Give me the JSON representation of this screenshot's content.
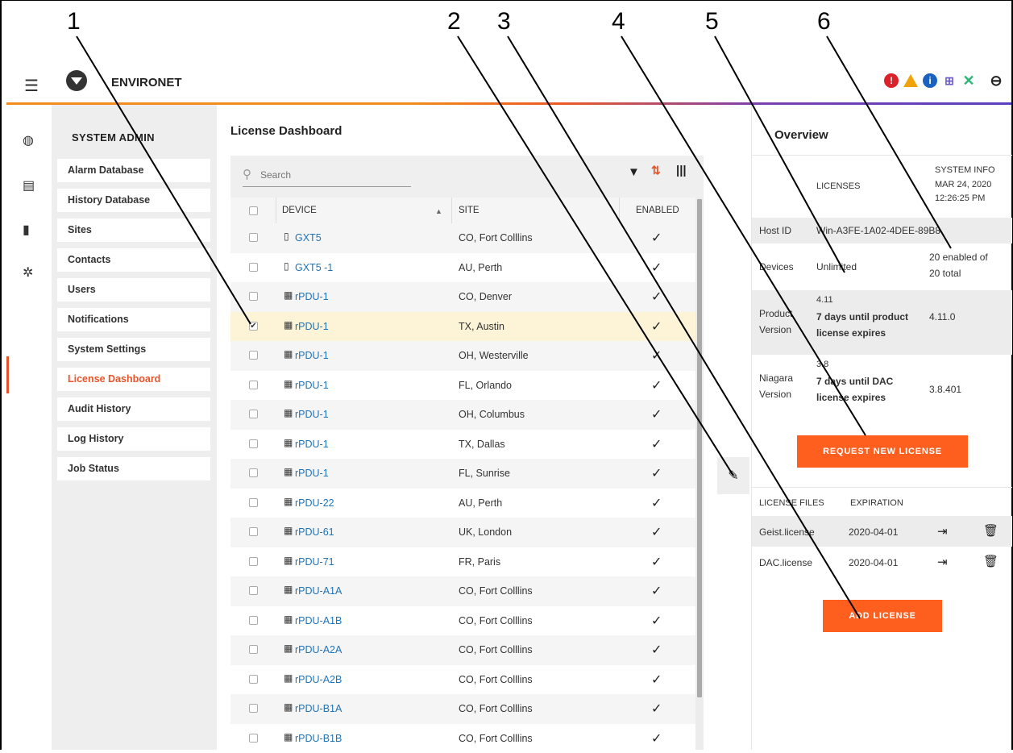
{
  "callouts": [
    "1",
    "2",
    "3",
    "4",
    "5",
    "6"
  ],
  "header": {
    "brand": "ENVIRONET",
    "icons": [
      "menu-icon",
      "vertiv-logo-icon",
      "alarm-icon",
      "warning-icon",
      "info-icon",
      "network-icon",
      "tools-icon",
      "user-icon"
    ],
    "colors": {
      "alarm": "#d9222a",
      "warning": "#f0a30a",
      "info": "#1a62c0",
      "network": "#6a5acd",
      "tools": "#2bb673",
      "accent": "#e8542a"
    }
  },
  "rail": [
    "globe-icon",
    "reports-icon",
    "devices-icon",
    "settings-icon"
  ],
  "sidebar": {
    "title": "SYSTEM ADMIN",
    "items": [
      {
        "label": "Alarm Database"
      },
      {
        "label": "History Database"
      },
      {
        "label": "Sites"
      },
      {
        "label": "Contacts"
      },
      {
        "label": "Users"
      },
      {
        "label": "Notifications"
      },
      {
        "label": "System Settings"
      },
      {
        "label": "License Dashboard",
        "active": true
      },
      {
        "label": "Audit History"
      },
      {
        "label": "Log History"
      },
      {
        "label": "Job Status"
      }
    ]
  },
  "main": {
    "title": "License Dashboard",
    "search_placeholder": "Search",
    "columns": [
      "DEVICE",
      "SITE",
      "ENABLED"
    ],
    "rows": [
      {
        "device": "GXT5",
        "icon": "ups",
        "site": "CO, Fort Colllins",
        "enabled": true,
        "checked": false
      },
      {
        "device": "GXT5 -1",
        "icon": "ups",
        "site": "AU, Perth",
        "enabled": true,
        "checked": false
      },
      {
        "device": "rPDU-1",
        "icon": "pdu",
        "site": "CO, Denver",
        "enabled": true,
        "checked": false
      },
      {
        "device": "rPDU-1",
        "icon": "pdu",
        "site": "TX, Austin",
        "enabled": true,
        "checked": true
      },
      {
        "device": "rPDU-1",
        "icon": "pdu",
        "site": "OH, Westerville",
        "enabled": true,
        "checked": false
      },
      {
        "device": "rPDU-1",
        "icon": "pdu",
        "site": "FL, Orlando",
        "enabled": true,
        "checked": false
      },
      {
        "device": "rPDU-1",
        "icon": "pdu",
        "site": "OH, Columbus",
        "enabled": true,
        "checked": false
      },
      {
        "device": "rPDU-1",
        "icon": "pdu",
        "site": "TX, Dallas",
        "enabled": true,
        "checked": false
      },
      {
        "device": "rPDU-1",
        "icon": "pdu",
        "site": "FL, Sunrise",
        "enabled": true,
        "checked": false
      },
      {
        "device": "rPDU-22",
        "icon": "pdu",
        "site": "AU, Perth",
        "enabled": true,
        "checked": false
      },
      {
        "device": "rPDU-61",
        "icon": "pdu",
        "site": "UK, London",
        "enabled": true,
        "checked": false
      },
      {
        "device": "rPDU-71",
        "icon": "pdu",
        "site": "FR, Paris",
        "enabled": true,
        "checked": false
      },
      {
        "device": "rPDU-A1A",
        "icon": "pdu",
        "site": "CO, Fort Colllins",
        "enabled": true,
        "checked": false
      },
      {
        "device": "rPDU-A1B",
        "icon": "pdu",
        "site": "CO, Fort Colllins",
        "enabled": true,
        "checked": false
      },
      {
        "device": "rPDU-A2A",
        "icon": "pdu",
        "site": "CO, Fort Colllins",
        "enabled": true,
        "checked": false
      },
      {
        "device": "rPDU-A2B",
        "icon": "pdu",
        "site": "CO, Fort Colllins",
        "enabled": true,
        "checked": false
      },
      {
        "device": "rPDU-B1A",
        "icon": "pdu",
        "site": "CO, Fort Colllins",
        "enabled": true,
        "checked": false
      },
      {
        "device": "rPDU-B1B",
        "icon": "pdu",
        "site": "CO, Fort Colllins",
        "enabled": true,
        "checked": false
      }
    ]
  },
  "overview": {
    "title": "Overview",
    "col_licenses": "LICENSES",
    "col_system_info": "SYSTEM INFO",
    "system_date": "MAR 24, 2020",
    "system_time": "12:26:25 PM",
    "host_id_label": "Host ID",
    "host_id_value": "Win-A3FE-1A02-4DEE-89B8",
    "devices_label": "Devices",
    "devices_value": "Unlimited",
    "devices_info_1": "20 enabled of",
    "devices_info_2": "20 total",
    "product_label_1": "Product",
    "product_label_2": "Version",
    "product_version": "4.11",
    "product_warning_1": "7 days until product",
    "product_warning_2": "license expires",
    "product_system": "4.11.0",
    "niagara_label_1": "Niagara",
    "niagara_label_2": "Version",
    "niagara_version": "3.8",
    "niagara_warning_1": "7 days until DAC",
    "niagara_warning_2": "license expires",
    "niagara_system": "3.8.401",
    "request_button": "REQUEST NEW LICENSE",
    "files_header": "LICENSE FILES",
    "expiration_header": "EXPIRATION",
    "files": [
      {
        "name": "Geist.license",
        "expiration": "2020-04-01"
      },
      {
        "name": "DAC.license",
        "expiration": "2020-04-01"
      }
    ],
    "add_button": "ADD LICENSE"
  }
}
